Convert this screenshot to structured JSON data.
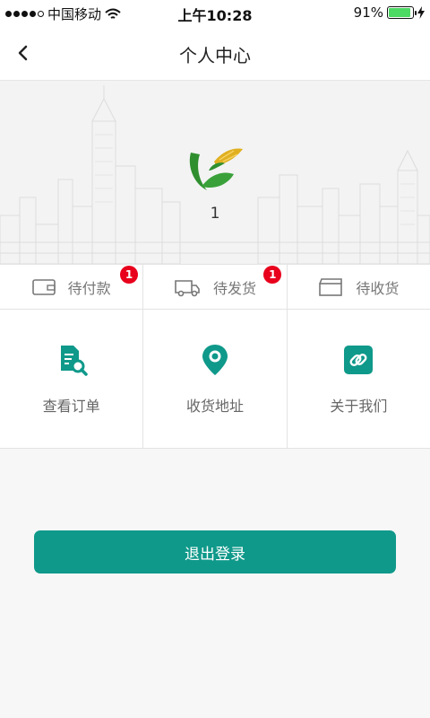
{
  "status_bar": {
    "carrier": "中国移动",
    "time": "上午10:28",
    "battery": "91%",
    "battery_level": 0.91
  },
  "nav": {
    "title": "个人中心",
    "back_icon": "chevron-left-icon"
  },
  "profile": {
    "user_name": "1",
    "avatar_icon": "leaf-logo"
  },
  "orders": [
    {
      "label": "待付款",
      "badge": "1",
      "icon": "wallet-icon"
    },
    {
      "label": "待发货",
      "badge": "1",
      "icon": "truck-icon"
    },
    {
      "label": "待收货",
      "badge": "",
      "icon": "package-icon"
    }
  ],
  "menu": [
    {
      "label": "查看订单",
      "icon": "order-search-icon"
    },
    {
      "label": "收货地址",
      "icon": "location-pin-icon"
    },
    {
      "label": "关于我们",
      "icon": "link-icon"
    }
  ],
  "logout": {
    "label": "退出登录"
  },
  "colors": {
    "accent": "#0f998a",
    "badge": "#e8001c"
  }
}
